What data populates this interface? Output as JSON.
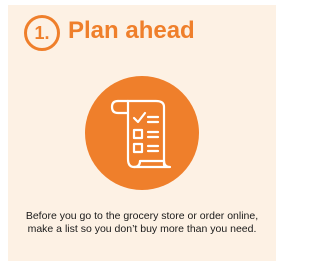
{
  "step": {
    "number": "1.",
    "title": "Plan ahead"
  },
  "illustration": {
    "icon": "shopping-list-checklist-icon",
    "color_primary": "#ef7f2b",
    "color_line": "#ffffff"
  },
  "description": "Before you go to the grocery store or order online, make a list so you don’t buy more than you need.",
  "colors": {
    "accent": "#ef7f2b",
    "card_background": "#fdf1e4",
    "text": "#1a1a1a"
  }
}
